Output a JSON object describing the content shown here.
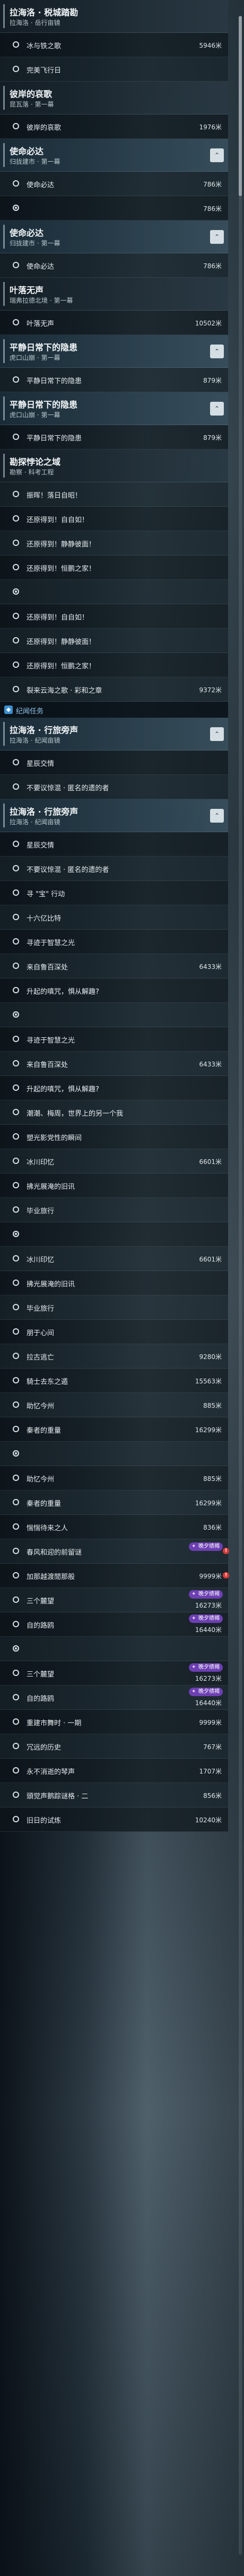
{
  "section_label": "纪闻任务",
  "alert_glyph": "!",
  "badge_text": "晚夕绩褐",
  "quest_list": [
    {
      "kind": "header",
      "title": "拉海洛 · 税城踏勘",
      "sub": "拉海洛 · 岳行亩镜"
    },
    {
      "kind": "item",
      "label": "冰与铁之歌",
      "dist": "5946米"
    },
    {
      "kind": "item",
      "label": "完美飞行日",
      "dist": ""
    },
    {
      "kind": "header",
      "title": "彼岸的哀歌",
      "sub": "昆瓦落 · 第一幕"
    },
    {
      "kind": "item",
      "label": "彼岸的哀歌",
      "dist": "1976米"
    },
    {
      "kind": "header",
      "title": "使命必达",
      "sub": "归拢建市 · 第一幕",
      "toggle": "⌃"
    },
    {
      "kind": "item",
      "label": "使命必达",
      "dist": "786米"
    },
    {
      "kind": "item",
      "label": "",
      "dist": "786米"
    },
    {
      "kind": "header",
      "title": "使命必达",
      "sub": "归拢建市 · 第一幕",
      "toggle": "⌃"
    },
    {
      "kind": "item",
      "label": "使命必达",
      "dist": "786米"
    },
    {
      "kind": "header",
      "title": "叶落无声",
      "sub": "瑞弗拉德北境 · 第一幕"
    },
    {
      "kind": "item",
      "label": "叶落无声",
      "dist": "10502米"
    },
    {
      "kind": "header",
      "title": "平静日常下的隐患",
      "sub": "虎口山崩 · 第一幕",
      "toggle": "⌃"
    },
    {
      "kind": "item",
      "label": "平静日常下的隐患",
      "dist": "879米"
    },
    {
      "kind": "header",
      "title": "平静日常下的隐患",
      "sub": "虎口山崩 · 第一幕",
      "toggle": "⌃"
    },
    {
      "kind": "item",
      "label": "平静日常下的隐患",
      "dist": "879米"
    },
    {
      "kind": "header",
      "title": "勘探悖论之域",
      "sub": "勘察 · 科考工程"
    },
    {
      "kind": "item",
      "label": "振晖！落日自昭！",
      "dist": ""
    },
    {
      "kind": "item",
      "label": "还原得到！自自如！",
      "dist": ""
    },
    {
      "kind": "item",
      "label": "还原得到！静静彼面！",
      "dist": ""
    },
    {
      "kind": "item",
      "label": "还原得到！恒鹏之家！",
      "dist": ""
    },
    {
      "kind": "item",
      "label": "",
      "dist": ""
    },
    {
      "kind": "item",
      "label": "还原得到！自自如！",
      "dist": ""
    },
    {
      "kind": "item",
      "label": "还原得到！静静彼面！",
      "dist": ""
    },
    {
      "kind": "item",
      "label": "还原得到！恒鹏之家！",
      "dist": ""
    },
    {
      "kind": "item",
      "label": "裂来云海之歌 · 彩和之章",
      "dist": "9372米"
    },
    {
      "kind": "section"
    },
    {
      "kind": "header",
      "title": "拉海洛 · 行旅旁声",
      "sub": "拉海洛 · 纪闻亩镜",
      "toggle": "⌃"
    },
    {
      "kind": "item",
      "label": "星辰交情",
      "dist": ""
    },
    {
      "kind": "item",
      "label": "不要议惊混 · 匿名的遗的者",
      "dist": ""
    },
    {
      "kind": "header",
      "title": "拉海洛 · 行旅旁声",
      "sub": "拉海洛 · 纪闻亩镜",
      "toggle": "⌃"
    },
    {
      "kind": "item",
      "label": "星辰交情",
      "dist": ""
    },
    {
      "kind": "item",
      "label": "不要议惊混 · 匿名的遗的者",
      "dist": ""
    },
    {
      "kind": "item",
      "label": "寻 \"宝\" 行动",
      "dist": ""
    },
    {
      "kind": "item",
      "label": "十六亿比特",
      "dist": ""
    },
    {
      "kind": "item",
      "label": "寻迹于智慧之光",
      "dist": ""
    },
    {
      "kind": "item",
      "label": "来自鲁百深处",
      "dist": "6433米"
    },
    {
      "kind": "item",
      "label": "升起的嗔咒，惧从解趣?",
      "dist": ""
    },
    {
      "kind": "item",
      "label": "",
      "dist": ""
    },
    {
      "kind": "item",
      "label": "寻迹于智慧之光",
      "dist": ""
    },
    {
      "kind": "item",
      "label": "来自鲁百深处",
      "dist": "6433米"
    },
    {
      "kind": "item",
      "label": "升起的嗔咒，惧从解趣?",
      "dist": ""
    },
    {
      "kind": "item",
      "label": "潮潮、梅周，世界上的另一个我",
      "dist": ""
    },
    {
      "kind": "item",
      "label": "塑光影党性的瞬间",
      "dist": ""
    },
    {
      "kind": "item",
      "label": "冰川印忆",
      "dist": "6601米"
    },
    {
      "kind": "item",
      "label": "拂光展淹的旧讯",
      "dist": ""
    },
    {
      "kind": "item",
      "label": "毕业旅行",
      "dist": ""
    },
    {
      "kind": "item",
      "label": "",
      "dist": ""
    },
    {
      "kind": "item",
      "label": "冰川印忆",
      "dist": "6601米"
    },
    {
      "kind": "item",
      "label": "拂光展淹的旧讯",
      "dist": ""
    },
    {
      "kind": "item",
      "label": "毕业旅行",
      "dist": ""
    },
    {
      "kind": "item",
      "label": "朋于心间",
      "dist": ""
    },
    {
      "kind": "item",
      "label": "拉古逃亡",
      "dist": "9280米"
    },
    {
      "kind": "item",
      "label": "騎士去东之遁",
      "dist": "15563米"
    },
    {
      "kind": "item",
      "label": "助忆今州",
      "dist": "885米"
    },
    {
      "kind": "item",
      "label": "秦者的重量",
      "dist": "16299米"
    },
    {
      "kind": "item",
      "label": "",
      "dist": ""
    },
    {
      "kind": "item",
      "label": "助忆今州",
      "dist": "885米"
    },
    {
      "kind": "item",
      "label": "秦者的重量",
      "dist": "16299米"
    },
    {
      "kind": "item",
      "label": "惴惴待来之人",
      "dist": "836米"
    },
    {
      "kind": "item",
      "label": "春风和迎的前留谜",
      "dist": "",
      "badge": true,
      "alert": true
    },
    {
      "kind": "item",
      "label": "加那越渡閒那般",
      "dist": "9999米",
      "alert": true
    },
    {
      "kind": "item",
      "label": "三个麓望",
      "dist": "16273米",
      "badge": true
    },
    {
      "kind": "item",
      "label": "自的路鸥",
      "dist": "16440米",
      "badge": true
    },
    {
      "kind": "item",
      "label": "",
      "dist": ""
    },
    {
      "kind": "item",
      "label": "三个麓望",
      "dist": "16273米",
      "badge": true
    },
    {
      "kind": "item",
      "label": "自的路鸥",
      "dist": "16440米",
      "badge": true
    },
    {
      "kind": "item",
      "label": "重建市舞时 · 一期",
      "dist": "9999米"
    },
    {
      "kind": "item",
      "label": "冗远的历史",
      "dist": "767米"
    },
    {
      "kind": "item",
      "label": "永不消逝的琴声",
      "dist": "1707米"
    },
    {
      "kind": "item",
      "label": "頭觉声鹅踪谜格 · 二",
      "dist": "856米"
    },
    {
      "kind": "item",
      "label": "旧日的试炼",
      "dist": "10240米"
    }
  ]
}
